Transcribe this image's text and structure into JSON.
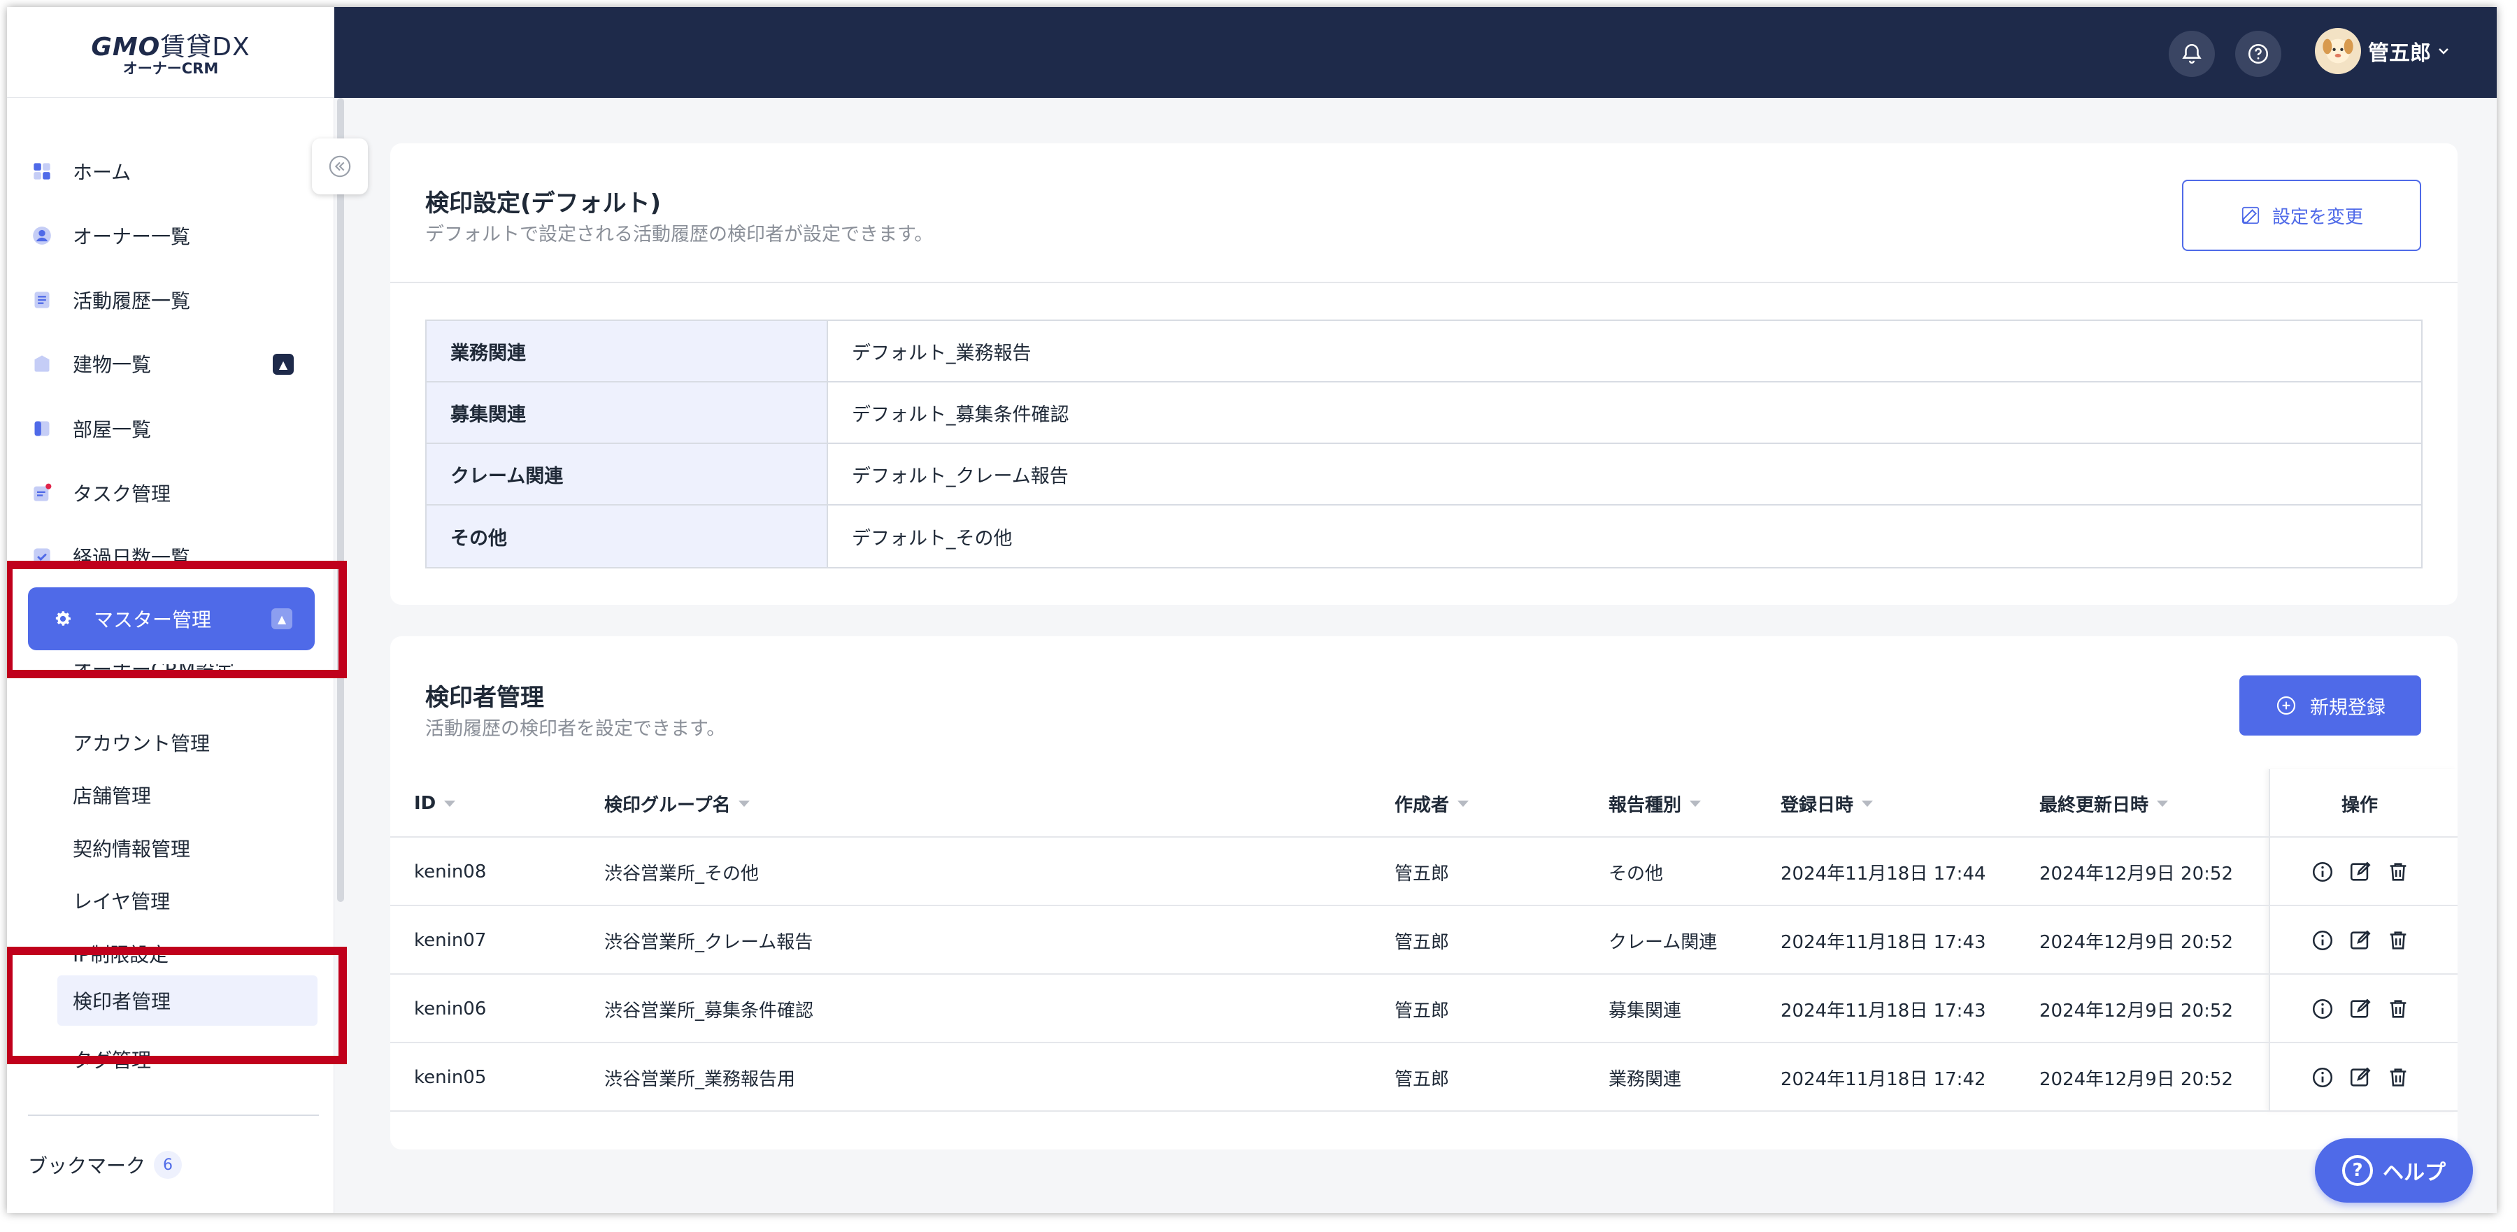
{
  "brand": {
    "logo_gmo": "GMO",
    "logo_suffix": "賃貸DX",
    "logo_sub": "オーナーCRM"
  },
  "sidebar": {
    "items": [
      {
        "label": "ホーム",
        "icon": "home-icon"
      },
      {
        "label": "オーナー一覧",
        "icon": "owner-icon"
      },
      {
        "label": "活動履歴一覧",
        "icon": "document-icon"
      },
      {
        "label": "建物一覧",
        "icon": "building-icon"
      },
      {
        "label": "部屋一覧",
        "icon": "room-icon"
      },
      {
        "label": "タスク管理",
        "icon": "task-icon"
      },
      {
        "label": "経過日数一覧",
        "icon": "check-icon"
      }
    ],
    "active": {
      "label": "マスター管理",
      "icon": "gear-icon"
    },
    "sub_items": [
      "オーナーCRM設定",
      "アカウント管理",
      "店舗管理",
      "契約情報管理",
      "レイヤ管理",
      "IP制限設定",
      "検印者管理",
      "タグ管理"
    ],
    "bookmark_label": "ブックマーク",
    "bookmark_count": "6"
  },
  "header": {
    "user_name": "管五郎"
  },
  "default_settings": {
    "title": "検印設定(デフォルト)",
    "description": "デフォルトで設定される活動履歴の検印者が設定できます。",
    "edit_label": "設定を変更",
    "rows": [
      {
        "key": "業務関連",
        "value": "デフォルト_業務報告"
      },
      {
        "key": "募集関連",
        "value": "デフォルト_募集条件確認"
      },
      {
        "key": "クレーム関連",
        "value": "デフォルト_クレーム報告"
      },
      {
        "key": "その他",
        "value": "デフォルト_その他"
      }
    ]
  },
  "approver_mgmt": {
    "title": "検印者管理",
    "description": "活動履歴の検印者を設定できます。",
    "new_label": "新規登録",
    "columns": [
      "ID",
      "検印グループ名",
      "作成者",
      "報告種別",
      "登録日時",
      "最終更新日時",
      "操作"
    ],
    "rows": [
      {
        "id": "kenin08",
        "group": "渋谷営業所_その他",
        "creator": "管五郎",
        "type": "その他",
        "created": "2024年11月18日 17:44",
        "updated": "2024年12月9日 20:52"
      },
      {
        "id": "kenin07",
        "group": "渋谷営業所_クレーム報告",
        "creator": "管五郎",
        "type": "クレーム関連",
        "created": "2024年11月18日 17:43",
        "updated": "2024年12月9日 20:52"
      },
      {
        "id": "kenin06",
        "group": "渋谷営業所_募集条件確認",
        "creator": "管五郎",
        "type": "募集関連",
        "created": "2024年11月18日 17:43",
        "updated": "2024年12月9日 20:52"
      },
      {
        "id": "kenin05",
        "group": "渋谷営業所_業務報告用",
        "creator": "管五郎",
        "type": "業務関連",
        "created": "2024年11月18日 17:42",
        "updated": "2024年12月9日 20:52"
      }
    ]
  },
  "help_label": "ヘルプ",
  "colors": {
    "accent": "#4f6ae8",
    "header": "#1e2a4a",
    "highlight": "#c0001c"
  }
}
